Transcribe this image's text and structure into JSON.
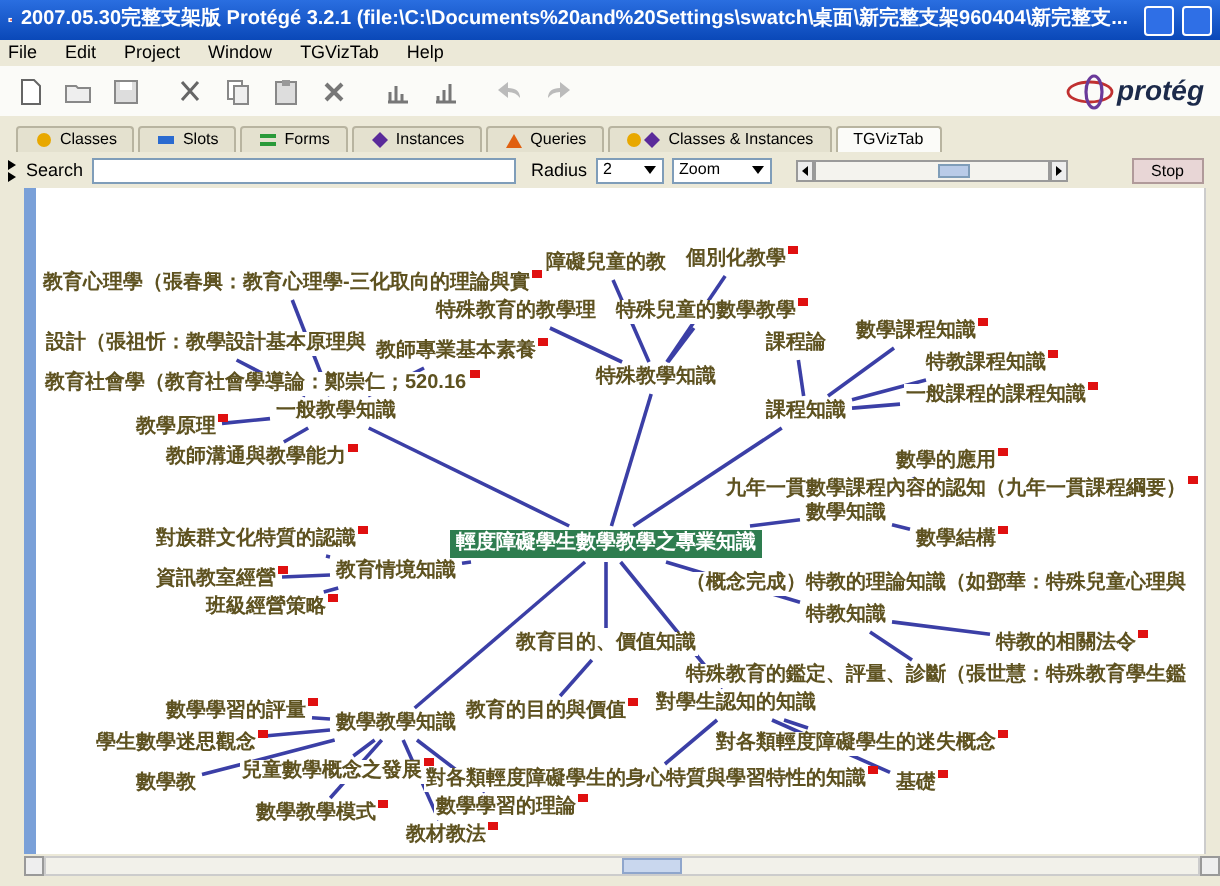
{
  "window": {
    "title": "2007.05.30完整支架版  Protégé 3.2.1    (file:\\C:\\Documents%20and%20Settings\\swatch\\桌面\\新完整支架960404\\新完整支..."
  },
  "menu": [
    "File",
    "Edit",
    "Project",
    "Window",
    "TGVizTab",
    "Help"
  ],
  "toolbar": {
    "logo": "protég"
  },
  "tabs": [
    {
      "label": "Classes",
      "kind": "classes",
      "selected": false
    },
    {
      "label": "Slots",
      "kind": "slots",
      "selected": false
    },
    {
      "label": "Forms",
      "kind": "forms",
      "selected": false
    },
    {
      "label": "Instances",
      "kind": "instances",
      "selected": false
    },
    {
      "label": "Queries",
      "kind": "queries",
      "selected": false
    },
    {
      "label": "Classes & Instances",
      "kind": "classes_instances",
      "selected": false
    },
    {
      "label": "TGVizTab",
      "kind": "plain",
      "selected": true
    }
  ],
  "search_bar": {
    "search_label": "Search",
    "radius_label": "Radius",
    "radius_value": "2",
    "zoom_value": "Zoom",
    "slider": {
      "level": 0.6
    },
    "stop_button": "Stop"
  },
  "graph": {
    "root": {
      "label": "輕度障礙學生數學教學之專業知識",
      "selected": true,
      "flagged": false,
      "children": [
        {
          "label": "一般教學知識",
          "selected": false,
          "flagged": false,
          "children": [
            {
              "label": "教育心理學（張春興：教育心理學-三化取向的理論與實",
              "selected": false,
              "flagged": true
            },
            {
              "label": "設計（張祖忻：教學設計基本原理與",
              "selected": false,
              "flagged": false
            },
            {
              "label": "教師專業基本素養",
              "selected": false,
              "flagged": true
            },
            {
              "label": "教育社會學（教育社會學導論：鄭崇仁；520.16",
              "selected": false,
              "flagged": true
            },
            {
              "label": "教學原理",
              "selected": false,
              "flagged": true
            },
            {
              "label": "教師溝通與教學能力",
              "selected": false,
              "flagged": true
            }
          ]
        },
        {
          "label": "特殊教學知識",
          "selected": false,
          "flagged": false,
          "children": [
            {
              "label": "障礙兒童的教",
              "selected": false,
              "flagged": false
            },
            {
              "label": "個別化教學",
              "selected": false,
              "flagged": true
            },
            {
              "label": "特殊教育的教學理",
              "selected": false,
              "flagged": false
            },
            {
              "label": "特殊兒童的數學教學",
              "selected": false,
              "flagged": true
            }
          ]
        },
        {
          "label": "課程知識",
          "selected": false,
          "flagged": false,
          "children": [
            {
              "label": "課程論",
              "selected": false,
              "flagged": false
            },
            {
              "label": "數學課程知識",
              "selected": false,
              "flagged": true
            },
            {
              "label": "特教課程知識",
              "selected": false,
              "flagged": true
            },
            {
              "label": "一般課程的課程知識",
              "selected": false,
              "flagged": true
            }
          ]
        },
        {
          "label": "數學知識",
          "selected": false,
          "flagged": false,
          "children": [
            {
              "label": "數學的應用",
              "selected": false,
              "flagged": true
            },
            {
              "label": "九年一貫數學課程內容的認知（九年一貫課程綱要）",
              "selected": false,
              "flagged": true
            },
            {
              "label": "數學結構",
              "selected": false,
              "flagged": true
            }
          ]
        },
        {
          "label": "特教知識",
          "selected": false,
          "flagged": false,
          "children": [
            {
              "label": "（概念完成）特教的理論知識（如鄧華：特殊兒童心理與",
              "selected": false,
              "flagged": false
            },
            {
              "label": "特教的相關法令",
              "selected": false,
              "flagged": true
            },
            {
              "label": "特殊教育的鑑定、評量、診斷（張世慧：特殊教育學生鑑",
              "selected": false,
              "flagged": false
            }
          ]
        },
        {
          "label": "教育情境知識",
          "selected": false,
          "flagged": false,
          "children": [
            {
              "label": "對族群文化特質的認識",
              "selected": false,
              "flagged": true
            },
            {
              "label": "資訊教室經營",
              "selected": false,
              "flagged": true
            },
            {
              "label": "班級經營策略",
              "selected": false,
              "flagged": true
            }
          ]
        },
        {
          "label": "教育目的、價值知識",
          "selected": false,
          "flagged": false,
          "children": [
            {
              "label": "教育的目的與價值",
              "selected": false,
              "flagged": true
            }
          ]
        },
        {
          "label": "對學生認知的知識",
          "selected": false,
          "flagged": false,
          "children": [
            {
              "label": "對各類輕度障礙學生的迷失概念",
              "selected": false,
              "flagged": true
            },
            {
              "label": "對各類輕度障礙學生的身心特質與學習特性的知識",
              "selected": false,
              "flagged": true
            },
            {
              "label": "基礎",
              "selected": false,
              "flagged": true
            }
          ]
        },
        {
          "label": "數學教學知識",
          "selected": false,
          "flagged": false,
          "children": [
            {
              "label": "數學學習的評量",
              "selected": false,
              "flagged": true
            },
            {
              "label": "學生數學迷思觀念",
              "selected": false,
              "flagged": true
            },
            {
              "label": "兒童數學概念之發展",
              "selected": false,
              "flagged": true
            },
            {
              "label": "數學教",
              "selected": false,
              "flagged": false
            },
            {
              "label": "數學教學模式",
              "selected": false,
              "flagged": true
            },
            {
              "label": "數學學習的理論",
              "selected": false,
              "flagged": true
            },
            {
              "label": "教材教法",
              "selected": false,
              "flagged": true
            }
          ]
        }
      ]
    }
  }
}
